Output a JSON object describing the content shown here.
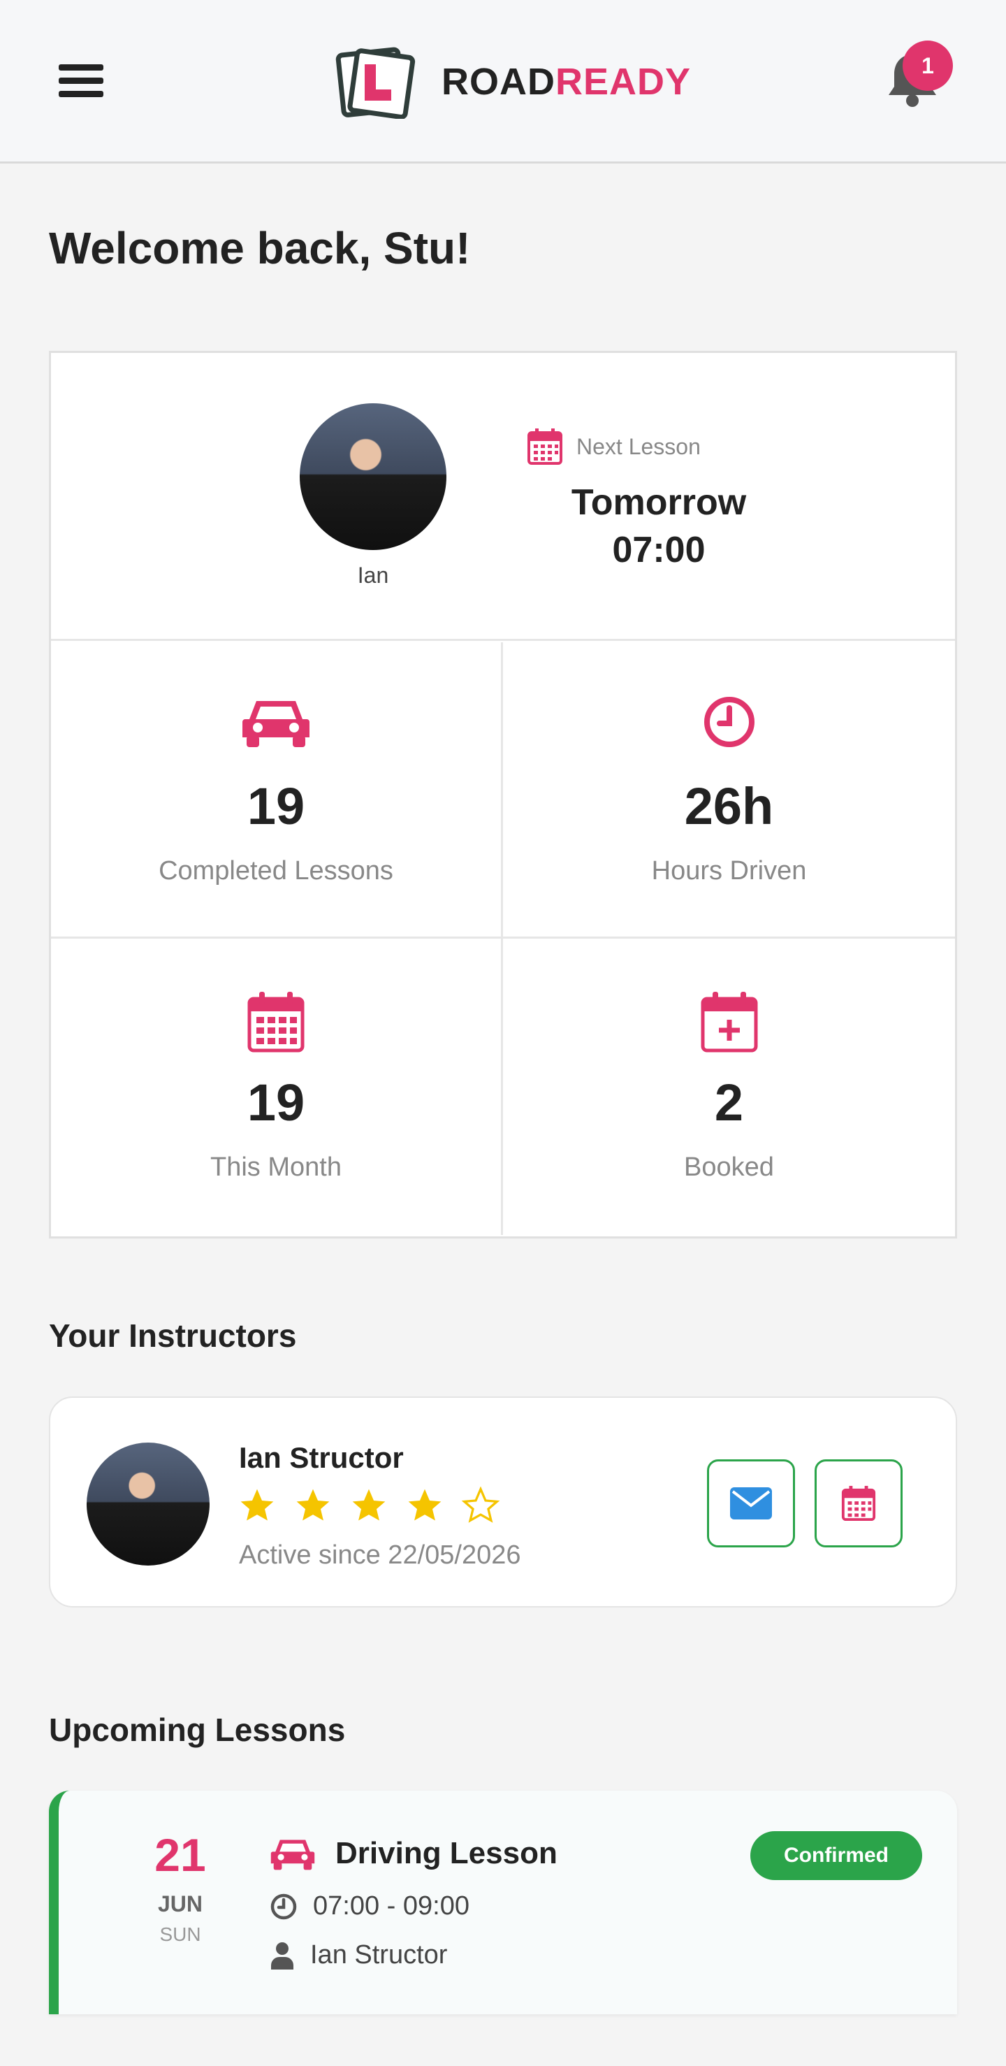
{
  "header": {
    "brand_part1": "ROAD",
    "brand_part2": "READY",
    "notification_count": "1",
    "icons": [
      "menu-icon",
      "logo-icon",
      "bell-icon"
    ]
  },
  "welcome": {
    "title": "Welcome back, Stu!"
  },
  "next_lesson": {
    "instructor_name": "Ian",
    "label": "Next Lesson",
    "day": "Tomorrow",
    "time": "07:00"
  },
  "stats": [
    {
      "value": "19",
      "label": "Completed Lessons",
      "icon": "car-icon"
    },
    {
      "value": "26h",
      "label": "Hours Driven",
      "icon": "clock-icon"
    },
    {
      "value": "19",
      "label": "This Month",
      "icon": "calendar-icon"
    },
    {
      "value": "2",
      "label": "Booked",
      "icon": "calendar-plus-icon"
    }
  ],
  "instructors": {
    "section_title": "Your Instructors",
    "items": [
      {
        "name": "Ian Structor",
        "rating": 4,
        "rating_max": 5,
        "active_since": "Active since 22/05/2026"
      }
    ]
  },
  "upcoming": {
    "section_title": "Upcoming Lessons",
    "items": [
      {
        "day": "21",
        "month": "JUN",
        "weekday": "SUN",
        "title": "Driving Lesson",
        "time": "07:00 - 09:00",
        "instructor": "Ian Structor",
        "status": "Confirmed"
      }
    ]
  },
  "colors": {
    "brand": "#e0356c",
    "success": "#2ba44a",
    "star": "#f5c400",
    "mail": "#2f8fe0"
  }
}
